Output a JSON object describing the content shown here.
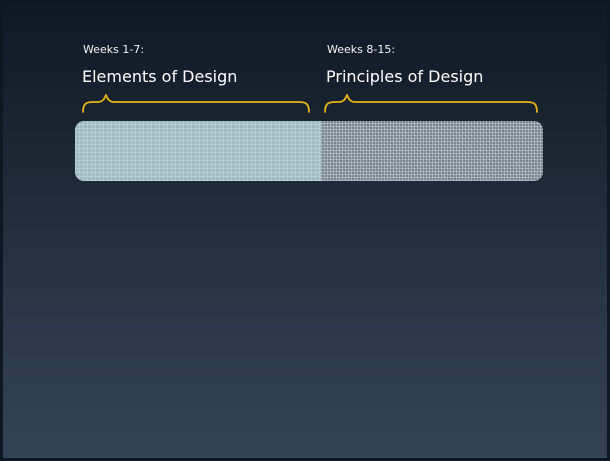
{
  "slide": {
    "sections": [
      {
        "weeks": "Weeks 1-7:",
        "title": "Elements of Design"
      },
      {
        "weeks": "Weeks 8-15:",
        "title": "Principles of Design"
      }
    ],
    "colors": {
      "background_top": "#0f1926",
      "background_bottom": "#334355",
      "brace": "#e8b418",
      "bar_left": "#9fbcc3",
      "bar_right": "#7f8c95",
      "text": "#ffffff"
    }
  }
}
